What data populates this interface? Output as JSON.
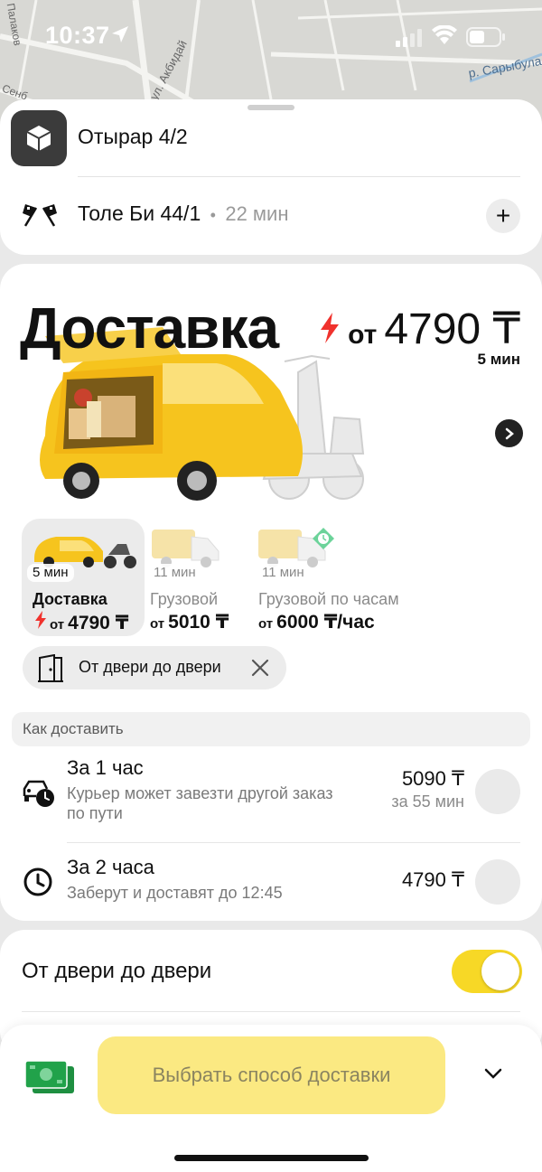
{
  "status_bar": {
    "time": "10:37"
  },
  "map": {
    "labels": [
      "ул. Акбидай",
      "р. Сарыбула",
      "Палаков",
      "Сенб"
    ]
  },
  "route": {
    "from": "Отырар 4/2",
    "to": "Толе Би 44/1",
    "separator": "•",
    "eta": "22 мин",
    "add_button": "+"
  },
  "hero": {
    "title": "Доставка",
    "price_prefix": "от",
    "price": "4790 ₸",
    "eta": "5 мин"
  },
  "tariffs": [
    {
      "eta": "5 мин",
      "name": "Доставка",
      "price_prefix": "от",
      "price": "4790 ₸",
      "selected": true
    },
    {
      "eta": "11 мин",
      "name": "Грузовой",
      "price_prefix": "от",
      "price": "5010 ₸",
      "selected": false
    },
    {
      "eta": "11 мин",
      "name": "Грузовой по часам",
      "price_prefix": "от",
      "price": "6000 ₸/час",
      "selected": false
    }
  ],
  "chip": {
    "label": "От двери до двери"
  },
  "delivery": {
    "section_title": "Как доставить",
    "options": [
      {
        "title": "За 1 час",
        "subtitle": "Курьер может завезти другой заказ по пути",
        "price": "5090 ₸",
        "price_sub": "за 55 мин"
      },
      {
        "title": "За 2 часа",
        "subtitle": "Заберут и доставят до 12:45",
        "price": "4790 ₸",
        "price_sub": ""
      }
    ]
  },
  "door_to_door": {
    "label": "От двери до двери",
    "enabled": true
  },
  "bottom": {
    "cta": "Выбрать способ доставки"
  },
  "colors": {
    "accent_yellow": "#f7d826",
    "cta_bg": "#fbe982",
    "lightning": "#f0322d",
    "payment_green": "#21a24a"
  }
}
